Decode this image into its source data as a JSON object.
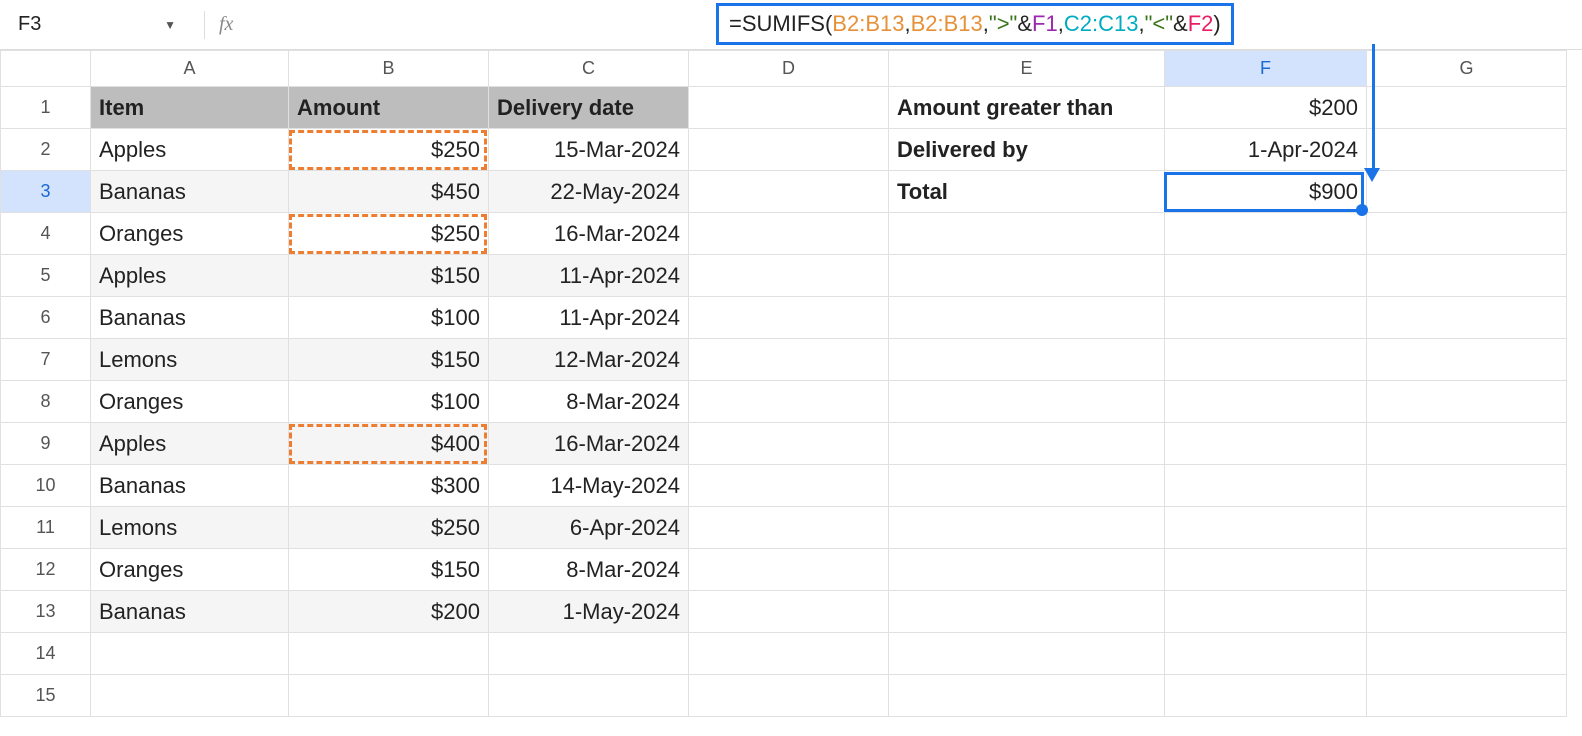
{
  "name_box": "F3",
  "formula_parts": {
    "p1": "=SUMIFS(",
    "p2": "B2:B13",
    "p3": ",",
    "p4": "B2:B13",
    "p5": ", ",
    "p6": "\">\"",
    "p7": "&",
    "p8": "F1",
    "p9": ",",
    "p10": "C2:C13",
    "p11": ", ",
    "p12": "\"<\"",
    "p13": "&",
    "p14": "F2",
    "p15": ")"
  },
  "columns": [
    "A",
    "B",
    "C",
    "D",
    "E",
    "F",
    "G"
  ],
  "row_numbers": [
    "1",
    "2",
    "3",
    "4",
    "5",
    "6",
    "7",
    "8",
    "9",
    "10",
    "11",
    "12",
    "13",
    "14",
    "15"
  ],
  "headers": {
    "A": "Item",
    "B": "Amount",
    "C": "Delivery date"
  },
  "side": {
    "e1": "Amount greater than",
    "f1": "$200",
    "e2": "Delivered by",
    "f2": "1-Apr-2024",
    "e3": "Total",
    "f3": "$900"
  },
  "rows": [
    {
      "A": "Apples",
      "B": "$250",
      "C": "15-Mar-2024"
    },
    {
      "A": "Bananas",
      "B": "$450",
      "C": "22-May-2024"
    },
    {
      "A": "Oranges",
      "B": "$250",
      "C": "16-Mar-2024"
    },
    {
      "A": "Apples",
      "B": "$150",
      "C": "11-Apr-2024"
    },
    {
      "A": "Bananas",
      "B": "$100",
      "C": "11-Apr-2024"
    },
    {
      "A": "Lemons",
      "B": "$150",
      "C": "12-Mar-2024"
    },
    {
      "A": "Oranges",
      "B": "$100",
      "C": "8-Mar-2024"
    },
    {
      "A": "Apples",
      "B": "$400",
      "C": "16-Mar-2024"
    },
    {
      "A": "Bananas",
      "B": "$300",
      "C": "14-May-2024"
    },
    {
      "A": "Lemons",
      "B": "$250",
      "C": "6-Apr-2024"
    },
    {
      "A": "Oranges",
      "B": "$150",
      "C": "8-Mar-2024"
    },
    {
      "A": "Bananas",
      "B": "$200",
      "C": "1-May-2024"
    }
  ],
  "highlighted_b_rows": [
    2,
    4,
    9
  ],
  "selected_cell": "F3",
  "chart_data": {
    "type": "table",
    "title": "SUMIFS example",
    "columns": [
      "Item",
      "Amount",
      "Delivery date"
    ],
    "rows": [
      [
        "Apples",
        250,
        "15-Mar-2024"
      ],
      [
        "Bananas",
        450,
        "22-May-2024"
      ],
      [
        "Oranges",
        250,
        "16-Mar-2024"
      ],
      [
        "Apples",
        150,
        "11-Apr-2024"
      ],
      [
        "Bananas",
        100,
        "11-Apr-2024"
      ],
      [
        "Lemons",
        150,
        "12-Mar-2024"
      ],
      [
        "Oranges",
        100,
        "8-Mar-2024"
      ],
      [
        "Apples",
        400,
        "16-Mar-2024"
      ],
      [
        "Bananas",
        300,
        "14-May-2024"
      ],
      [
        "Lemons",
        250,
        "6-Apr-2024"
      ],
      [
        "Oranges",
        150,
        "8-Mar-2024"
      ],
      [
        "Bananas",
        200,
        "1-May-2024"
      ]
    ],
    "criteria": {
      "amount_greater_than": 200,
      "delivered_by": "1-Apr-2024"
    },
    "result_total": 900
  }
}
